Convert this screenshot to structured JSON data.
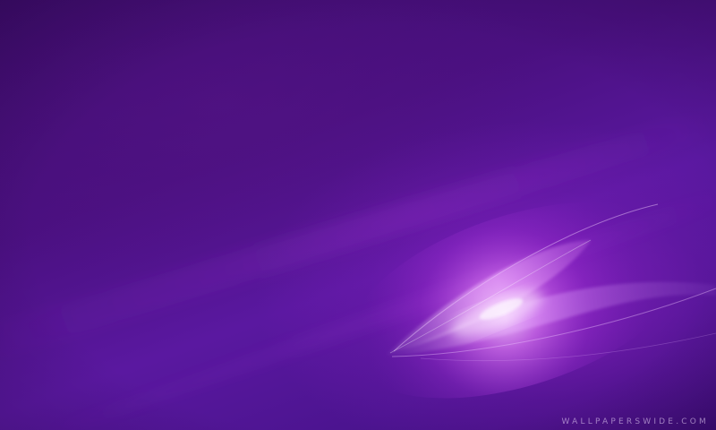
{
  "wallpaper": {
    "watermark": "WALLPAPERSWIDE.COM",
    "colors": {
      "base": "#3a0a6a",
      "mid": "#5a18a0",
      "glow": "#d07cf0",
      "highlight": "#f3c9ff"
    },
    "element": "abstract-light-swirl"
  }
}
